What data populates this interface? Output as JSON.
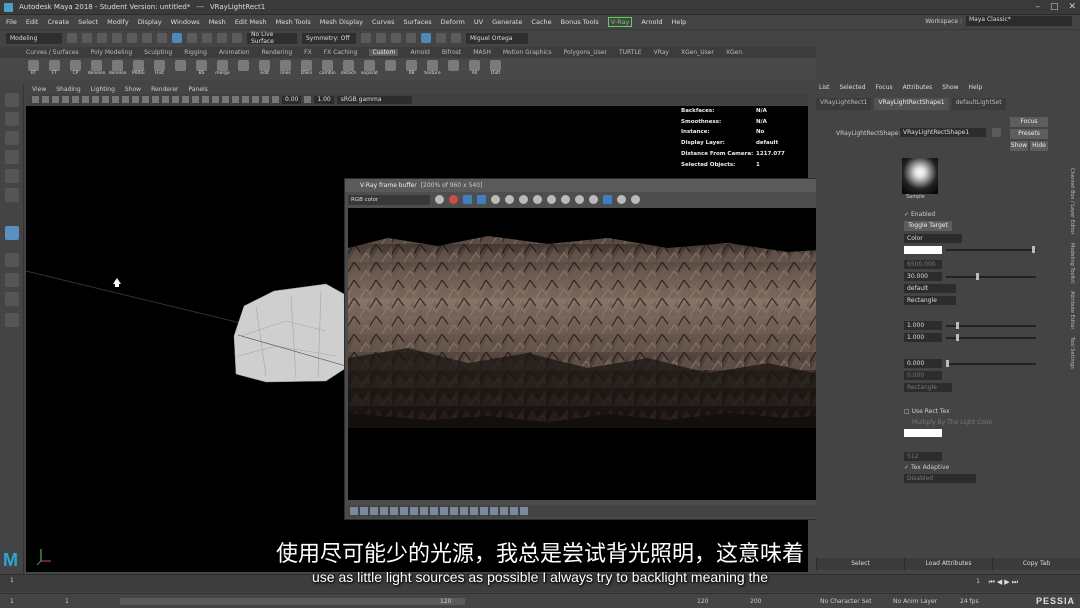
{
  "window": {
    "title_app": "Autodesk Maya 2018 - Student Version: untitled*",
    "title_sep": "---",
    "title_node": "VRayLightRect1"
  },
  "menu": [
    "File",
    "Edit",
    "Create",
    "Select",
    "Modify",
    "Display",
    "Windows",
    "Mesh",
    "Edit Mesh",
    "Mesh Tools",
    "Mesh Display",
    "Curves",
    "Surfaces",
    "Deform",
    "UV",
    "Generate",
    "Cache",
    "Bonus Tools",
    "V-Ray",
    "Arnold",
    "Help"
  ],
  "workspace": {
    "label": "Workspace :",
    "value": "Maya Classic*"
  },
  "status": {
    "mode": "Modeling",
    "live_surface": "No Live Surface",
    "symmetry": "Symmetry: Off",
    "user": "Miguel Ortega"
  },
  "shelf_tabs": [
    "Curves / Surfaces",
    "Poly Modeling",
    "Sculpting",
    "Rigging",
    "Animation",
    "Rendering",
    "FX",
    "FX Caching",
    "Custom",
    "Arnold",
    "Bifrost",
    "MASH",
    "Motion Graphics",
    "Polygons_User",
    "TURTLE",
    "VRay",
    "XGen_User",
    "XGen"
  ],
  "shelf_active": "Custom",
  "shelf_buttons": [
    "RT",
    "FT",
    "CP",
    "denoise",
    "denoise",
    "MUKE",
    "Hist",
    "",
    "BS",
    "merge",
    "",
    "edit",
    "lines",
    "DSlin",
    "combin",
    "detach",
    "separat",
    "",
    "08",
    "texture",
    "",
    "All",
    "Outl"
  ],
  "viewport": {
    "menu": [
      "View",
      "Shading",
      "Lighting",
      "Show",
      "Renderer",
      "Panels"
    ],
    "exposure": "0.00",
    "gamma_val": "1.00",
    "colorspace": "sRGB gamma"
  },
  "hud": [
    {
      "k": "Backfaces:",
      "v": "N/A"
    },
    {
      "k": "Smoothness:",
      "v": "N/A"
    },
    {
      "k": "Instance:",
      "v": "No"
    },
    {
      "k": "Display Layer:",
      "v": "default"
    },
    {
      "k": "Distance From Camera:",
      "v": "1217.077"
    },
    {
      "k": "Selected Objects:",
      "v": "1"
    }
  ],
  "vfb": {
    "title": "V-Ray frame buffer",
    "info": "[200% of 960 x 540]",
    "channel": "RGB color"
  },
  "attr_editor": {
    "menu": [
      "List",
      "Selected",
      "Focus",
      "Attributes",
      "Show",
      "Help"
    ],
    "tabs": [
      "VRayLightRect1",
      "VRayLightRectShape1",
      "defaultLightSet"
    ],
    "active_tab": "VRayLightRectShape1",
    "shape_label": "VRayLightRectShape:",
    "shape_value": "VRayLightRectShape1",
    "focus": "Focus",
    "presets": "Presets",
    "show": "Show",
    "hide": "Hide",
    "sample": "Sample",
    "enabled": "Enabled",
    "toggle_target": "Toggle Target",
    "color_mode": "Color",
    "temperature": "6500.000",
    "intensity": "30.000",
    "units": "default",
    "shape": "Rectangle",
    "u_size": "1.000",
    "v_size": "1.000",
    "directional": "0.000",
    "preview": "0.000",
    "preview_mode": "Rectangle",
    "use_rect_tex": "Use Rect Tex",
    "multiply": "Multiply By The Light Color",
    "tex_res": "512",
    "tex_adaptive": "Tex Adaptive",
    "tex_adaptive_mode": "Disabled"
  },
  "side_tabs": [
    "Channel Box / Layer Editor",
    "Modeling Toolkit",
    "Attribute Editor",
    "Tool Settings"
  ],
  "bottom_tabs": [
    "Select",
    "Load Attributes",
    "Copy Tab"
  ],
  "timeline": {
    "ticks": [
      "1",
      "",
      "",
      "",
      "",
      "",
      "",
      "",
      "",
      "",
      "",
      "",
      "",
      "",
      "",
      "",
      "",
      "",
      "",
      "",
      "",
      "",
      ""
    ],
    "end": "1"
  },
  "range": {
    "start": "1",
    "start2": "1",
    "current": "120",
    "end": "120",
    "end2": "200",
    "charset": "No Character Set",
    "animlayer": "No Anim Layer",
    "fps": "24 fps"
  },
  "subtitles": {
    "cn": "使用尽可能少的光源，我总是尝试背光照明，这意味着",
    "en": "use as little light sources as possible I always try to backlight meaning the"
  },
  "watermark": "PESSIA",
  "colors": {
    "vray_green": "#5fd05f",
    "maya_blue": "#2fa6d6",
    "active_blue": "#5b8fbf"
  }
}
